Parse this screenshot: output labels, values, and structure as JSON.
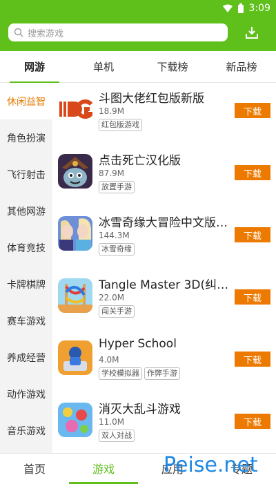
{
  "status": {
    "time": "3:09"
  },
  "search": {
    "placeholder": "搜索游戏"
  },
  "tabs": [
    {
      "label": "网游",
      "active": true
    },
    {
      "label": "单机",
      "active": false
    },
    {
      "label": "下载榜",
      "active": false
    },
    {
      "label": "新品榜",
      "active": false
    }
  ],
  "categories": [
    {
      "label": "休闲益智",
      "active": true
    },
    {
      "label": "角色扮演"
    },
    {
      "label": "飞行射击"
    },
    {
      "label": "其他网游"
    },
    {
      "label": "体育竞技"
    },
    {
      "label": "卡牌棋牌"
    },
    {
      "label": "赛车游戏"
    },
    {
      "label": "养成经营"
    },
    {
      "label": "动作游戏"
    },
    {
      "label": "音乐游戏"
    }
  ],
  "games": [
    {
      "title": "斗图大佬红包版新版",
      "size": "18.9M",
      "tags": [
        "红包版游戏"
      ],
      "button": "下载",
      "icon": "dou-tu-game-icon"
    },
    {
      "title": "点击死亡汉化版",
      "size": "87.9M",
      "tags": [
        "放置手游"
      ],
      "button": "下载",
      "icon": "click-death-game-icon"
    },
    {
      "title": "冰雪奇缘大冒险中文版…",
      "size": "144.3M",
      "tags": [
        "冰雪奇缘"
      ],
      "button": "下载",
      "icon": "frozen-game-icon"
    },
    {
      "title": "Tangle Master 3D(纠结…",
      "size": "22.0M",
      "tags": [
        "闯关手游"
      ],
      "button": "下载",
      "icon": "tangle-master-game-icon"
    },
    {
      "title": "Hyper School",
      "size": "4.0M",
      "tags": [
        "学校模拟器",
        "作弊手游"
      ],
      "button": "下载",
      "icon": "hyper-school-game-icon"
    },
    {
      "title": "消灭大乱斗游戏",
      "size": "11.0M",
      "tags": [
        "双人对战"
      ],
      "button": "下载",
      "icon": "melee-game-icon"
    }
  ],
  "bottom_nav": [
    {
      "label": "首页",
      "active": false
    },
    {
      "label": "游戏",
      "active": true
    },
    {
      "label": "应用",
      "active": false
    },
    {
      "label": "专题",
      "active": false
    }
  ],
  "watermark": "Peise.net",
  "colors": {
    "brand_green": "#5fbf1b",
    "download_orange": "#ec7a00",
    "active_category": "#e57a00"
  }
}
